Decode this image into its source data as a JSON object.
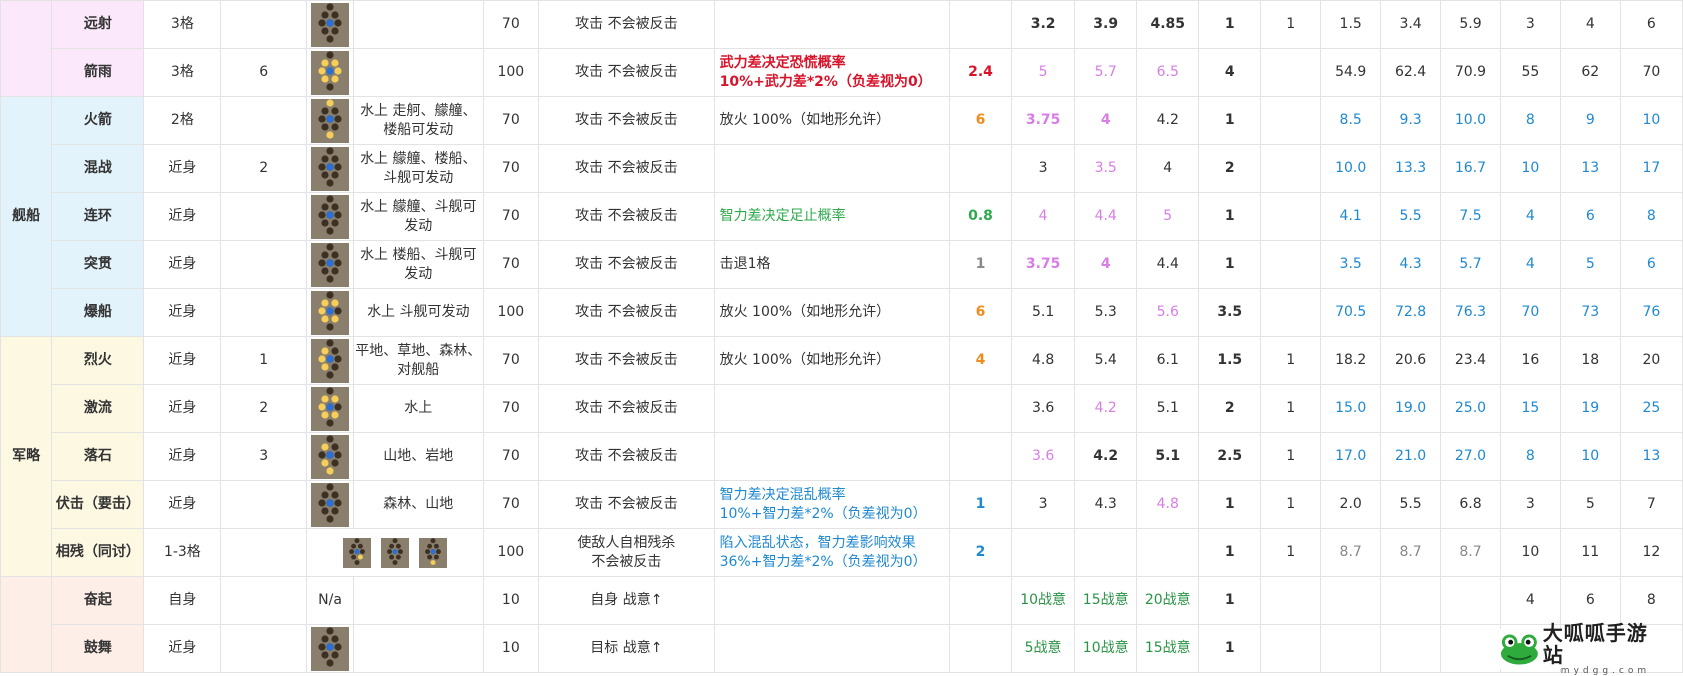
{
  "categories": {
    "ship": "舰船",
    "strategy": "军略"
  },
  "rows": [
    {
      "name": "远射",
      "range": "3格",
      "n": "",
      "place": "",
      "hit": "70",
      "desc": "攻击 不会被反击",
      "effect": "",
      "eff_val": "",
      "v1": "3.2",
      "v2": "3.9",
      "v3": "4.85",
      "v4": "1",
      "v5": "1",
      "v6": "1.5",
      "v7": "3.4",
      "v8": "5.9",
      "v9": "3",
      "v10": "4",
      "v11": "6"
    },
    {
      "name": "箭雨",
      "range": "3格",
      "n": "6",
      "place": "",
      "hit": "100",
      "desc": "攻击 不会被反击",
      "effect": "武力差决定恐慌概率",
      "effect2": "10%+武力差*2%（负差视为0）",
      "eff_val": "2.4",
      "v1": "5",
      "v2": "5.7",
      "v3": "6.5",
      "v4": "4",
      "v5": "",
      "v6": "54.9",
      "v7": "62.4",
      "v8": "70.9",
      "v9": "55",
      "v10": "62",
      "v11": "70"
    },
    {
      "name": "火箭",
      "range": "2格",
      "n": "",
      "place": "水上 走舸、艨艟、楼船可发动",
      "hit": "70",
      "desc": "攻击 不会被反击",
      "effect": "放火 100%（如地形允许）",
      "eff_val": "6",
      "v1": "3.75",
      "v2": "4",
      "v3": "4.2",
      "v4": "1",
      "v5": "",
      "v6": "8.5",
      "v7": "9.3",
      "v8": "10.0",
      "v9": "8",
      "v10": "9",
      "v11": "10"
    },
    {
      "name": "混战",
      "range": "近身",
      "n": "2",
      "place": "水上 艨艟、楼船、斗舰可发动",
      "hit": "70",
      "desc": "攻击 不会被反击",
      "effect": "",
      "eff_val": "",
      "v1": "3",
      "v2": "3.5",
      "v3": "4",
      "v4": "2",
      "v5": "",
      "v6": "10.0",
      "v7": "13.3",
      "v8": "16.7",
      "v9": "10",
      "v10": "13",
      "v11": "17"
    },
    {
      "name": "连环",
      "range": "近身",
      "n": "",
      "place": "水上 艨艟、斗舰可发动",
      "hit": "70",
      "desc": "攻击 不会被反击",
      "effect": "智力差决定足止概率",
      "eff_val": "0.8",
      "v1": "4",
      "v2": "4.4",
      "v3": "5",
      "v4": "1",
      "v5": "",
      "v6": "4.1",
      "v7": "5.5",
      "v8": "7.5",
      "v9": "4",
      "v10": "6",
      "v11": "8"
    },
    {
      "name": "突贯",
      "range": "近身",
      "n": "",
      "place": "水上 楼船、斗舰可发动",
      "hit": "70",
      "desc": "攻击 不会被反击",
      "effect": "击退1格",
      "eff_val": "1",
      "v1": "3.75",
      "v2": "4",
      "v3": "4.4",
      "v4": "1",
      "v5": "",
      "v6": "3.5",
      "v7": "4.3",
      "v8": "5.7",
      "v9": "4",
      "v10": "5",
      "v11": "6"
    },
    {
      "name": "爆船",
      "range": "近身",
      "n": "",
      "place": "水上 斗舰可发动",
      "hit": "100",
      "desc": "攻击 不会被反击",
      "effect": "放火 100%（如地形允许）",
      "eff_val": "6",
      "v1": "5.1",
      "v2": "5.3",
      "v3": "5.6",
      "v4": "3.5",
      "v5": "",
      "v6": "70.5",
      "v7": "72.8",
      "v8": "76.3",
      "v9": "70",
      "v10": "73",
      "v11": "76"
    },
    {
      "name": "烈火",
      "range": "近身",
      "n": "1",
      "place": "平地、草地、森林、对舰船",
      "hit": "70",
      "desc": "攻击 不会被反击",
      "effect": "放火 100%（如地形允许）",
      "eff_val": "4",
      "v1": "4.8",
      "v2": "5.4",
      "v3": "6.1",
      "v4": "1.5",
      "v5": "1",
      "v6": "18.2",
      "v7": "20.6",
      "v8": "23.4",
      "v9": "16",
      "v10": "18",
      "v11": "20"
    },
    {
      "name": "激流",
      "range": "近身",
      "n": "2",
      "place": "水上",
      "hit": "70",
      "desc": "攻击 不会被反击",
      "effect": "",
      "eff_val": "",
      "v1": "3.6",
      "v2": "4.2",
      "v3": "5.1",
      "v4": "2",
      "v5": "1",
      "v6": "15.0",
      "v7": "19.0",
      "v8": "25.0",
      "v9": "15",
      "v10": "19",
      "v11": "25"
    },
    {
      "name": "落石",
      "range": "近身",
      "n": "3",
      "place": "山地、岩地",
      "hit": "70",
      "desc": "攻击 不会被反击",
      "effect": "",
      "eff_val": "",
      "v1": "3.6",
      "v2": "4.2",
      "v3": "5.1",
      "v4": "2.5",
      "v5": "1",
      "v6": "17.0",
      "v7": "21.0",
      "v8": "27.0",
      "v9": "8",
      "v10": "10",
      "v11": "13"
    },
    {
      "name": "伏击（要击）",
      "range": "近身",
      "n": "",
      "place": "森林、山地",
      "hit": "70",
      "desc": "攻击 不会被反击",
      "effect": "智力差决定混乱概率",
      "effect2": "10%+智力差*2%（负差视为0）",
      "eff_val": "1",
      "v1": "3",
      "v2": "4.3",
      "v3": "4.8",
      "v4": "1",
      "v5": "1",
      "v6": "2.0",
      "v7": "5.5",
      "v8": "6.8",
      "v9": "3",
      "v10": "5",
      "v11": "7"
    },
    {
      "name": "相残（同讨）",
      "range": "1-3格",
      "n": "",
      "place": "",
      "hit": "100",
      "desc": "使敌人自相残杀",
      "desc2": "不会被反击",
      "effect": "陷入混乱状态，智力差影响效果",
      "effect2": "36%+智力差*2%（负差视为0）",
      "eff_val": "2",
      "v1": "",
      "v2": "",
      "v3": "",
      "v4": "1",
      "v5": "1",
      "v6": "8.7",
      "v7": "8.7",
      "v8": "8.7",
      "v9": "10",
      "v10": "11",
      "v11": "12"
    },
    {
      "name": "奋起",
      "range": "自身",
      "n": "",
      "icon_text": "N/a",
      "place": "",
      "hit": "10",
      "desc": "自身 战意↑",
      "effect": "",
      "eff_val": "",
      "v1": "10战意",
      "v2": "15战意",
      "v3": "20战意",
      "v4": "1",
      "v5": "",
      "v6": "",
      "v7": "",
      "v8": "",
      "v9": "4",
      "v10": "6",
      "v11": "8"
    },
    {
      "name": "鼓舞",
      "range": "近身",
      "n": "",
      "place": "",
      "hit": "10",
      "desc": "目标 战意↑",
      "effect": "",
      "eff_val": "",
      "v1": "5战意",
      "v2": "10战意",
      "v3": "15战意",
      "v4": "1",
      "v5": "",
      "v6": "",
      "v7": "",
      "v8": "",
      "v9": "",
      "v10": "",
      "v11": ""
    }
  ],
  "logo": {
    "title": "大呱呱手游站",
    "subtitle": "mydgg.com"
  },
  "colors": {
    "pink_bg": "#fbe9fb",
    "blue_bg": "#e3f3fc",
    "yellow_bg": "#fdf8e2",
    "peach_bg": "#fdeee8",
    "red": "#d8142b",
    "pink_text": "#d77ee6",
    "orange": "#f08b1e",
    "blue_text": "#1f89d0",
    "green": "#2eaa4c"
  }
}
